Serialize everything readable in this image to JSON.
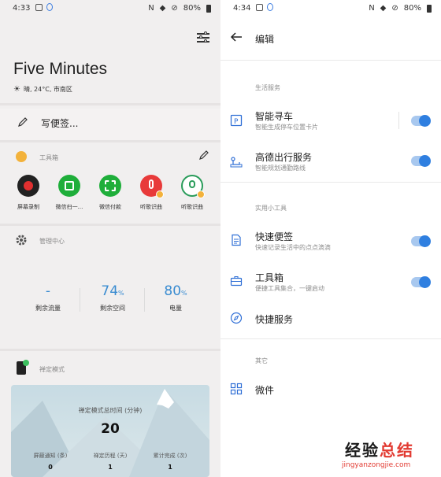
{
  "left_status": {
    "time": "4:33",
    "battery": "80%"
  },
  "right_status": {
    "time": "4:34",
    "battery": "80%"
  },
  "left": {
    "title": "Five Minutes",
    "weather": "晴, 24°C, 市南区",
    "quick_note": "写便签...",
    "toolbox_label": "工具箱",
    "tools": [
      {
        "label": "屏幕录制",
        "icon": "record-icon",
        "color": "#222222"
      },
      {
        "label": "微信扫一...",
        "icon": "wechat-scan-icon",
        "color": "#1fae3a"
      },
      {
        "label": "微信付款",
        "icon": "wechat-pay-icon",
        "color": "#1fae3a"
      },
      {
        "label": "听歌识曲",
        "icon": "music-recognize-icon",
        "color": "#e83a3a"
      },
      {
        "label": "听歌识曲",
        "icon": "music-recognize-alt-icon",
        "color": "#2a9c5a"
      }
    ],
    "manage_label": "管理中心",
    "stats": [
      {
        "value": "-",
        "unit": "",
        "label": "剩余流量"
      },
      {
        "value": "74",
        "unit": "%",
        "label": "剩余空间"
      },
      {
        "value": "80",
        "unit": "%",
        "label": "电量"
      }
    ],
    "focus_label": "禅定模式",
    "focus_card": {
      "title": "禅定模式总时间 (分钟)",
      "total": "20",
      "cols": [
        {
          "label": "屏蔽通知 (条)",
          "value": "0"
        },
        {
          "label": "禅定历程 (天)",
          "value": "1"
        },
        {
          "label": "累计完成 (次)",
          "value": "1"
        }
      ]
    }
  },
  "right": {
    "title": "编辑",
    "groups": [
      {
        "header": "生活服务"
      },
      {
        "header": "实用小工具"
      },
      {
        "header": "其它"
      }
    ],
    "items": [
      {
        "title": "智能寻车",
        "subtitle": "智能生成停车位置卡片",
        "icon": "parking-icon",
        "toggle": "on"
      },
      {
        "title": "高德出行服务",
        "subtitle": "智能规划通勤路线",
        "icon": "route-icon",
        "toggle": "on"
      },
      {
        "title": "快速便签",
        "subtitle": "快速记录生活中的点点滴滴",
        "icon": "note-icon",
        "toggle": "on"
      },
      {
        "title": "工具箱",
        "subtitle": "便捷工具集合，一键启动",
        "icon": "toolbox-icon",
        "toggle": "on"
      },
      {
        "title": "快捷服务",
        "subtitle": "",
        "icon": "compass-icon",
        "toggle": ""
      },
      {
        "title": "微件",
        "subtitle": "",
        "icon": "widgets-icon",
        "toggle": ""
      }
    ],
    "accent": "#2f7fe0"
  },
  "watermark": {
    "main_a": "经验",
    "main_b": "总结",
    "url": "jingyanzongjie.com"
  }
}
